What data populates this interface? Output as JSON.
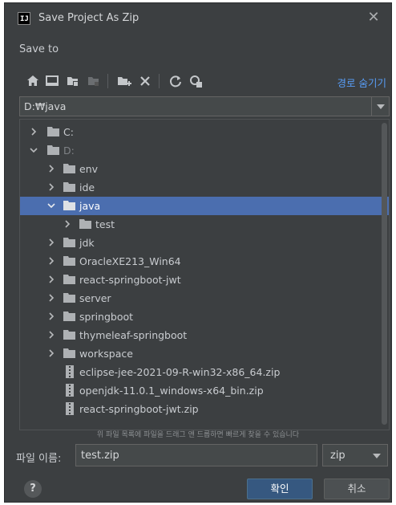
{
  "window": {
    "title": "Save Project As Zip",
    "logo_text": "IJ"
  },
  "section": {
    "save_to_label": "Save to"
  },
  "toolbar": {
    "hide_path_label": "경로 숨기기"
  },
  "path": {
    "value": "D:₩java"
  },
  "tree": {
    "items": [
      {
        "label": "C:",
        "type": "folder",
        "state": "collapsed",
        "dim": false
      },
      {
        "label": "D:",
        "type": "folder",
        "state": "expanded",
        "dim": true
      },
      {
        "label": "env",
        "type": "folder",
        "state": "collapsed",
        "dim": false
      },
      {
        "label": "ide",
        "type": "folder",
        "state": "collapsed",
        "dim": false
      },
      {
        "label": "java",
        "type": "folder",
        "state": "expanded",
        "selected": true
      },
      {
        "label": "test",
        "type": "folder",
        "state": "collapsed",
        "dim": false
      },
      {
        "label": "jdk",
        "type": "folder",
        "state": "collapsed",
        "dim": false
      },
      {
        "label": "OracleXE213_Win64",
        "type": "folder",
        "state": "collapsed",
        "dim": false
      },
      {
        "label": "react-springboot-jwt",
        "type": "folder",
        "state": "collapsed",
        "dim": false
      },
      {
        "label": "server",
        "type": "folder",
        "state": "collapsed",
        "dim": false
      },
      {
        "label": "springboot",
        "type": "folder",
        "state": "collapsed",
        "dim": false
      },
      {
        "label": "thymeleaf-springboot",
        "type": "folder",
        "state": "collapsed",
        "dim": false
      },
      {
        "label": "workspace",
        "type": "folder",
        "state": "collapsed",
        "dim": false
      },
      {
        "label": "eclipse-jee-2021-09-R-win32-x86_64.zip",
        "type": "zip"
      },
      {
        "label": "openjdk-11.0.1_windows-x64_bin.zip",
        "type": "zip"
      },
      {
        "label": "react-springboot-jwt.zip",
        "type": "zip"
      }
    ]
  },
  "hint": "위 파일 목록에 파일을 드래그 앤 드롭하면 빠르게 찾을 수 있습니다",
  "filename": {
    "label": "파일 이름:",
    "value": "test.zip"
  },
  "extension": {
    "selected": "zip"
  },
  "buttons": {
    "help": "?",
    "ok": "확인",
    "cancel": "취소"
  },
  "colors": {
    "background": "#3c3f41",
    "selection": "#4b6eaf",
    "link": "#589df6",
    "primary_button": "#365880"
  }
}
